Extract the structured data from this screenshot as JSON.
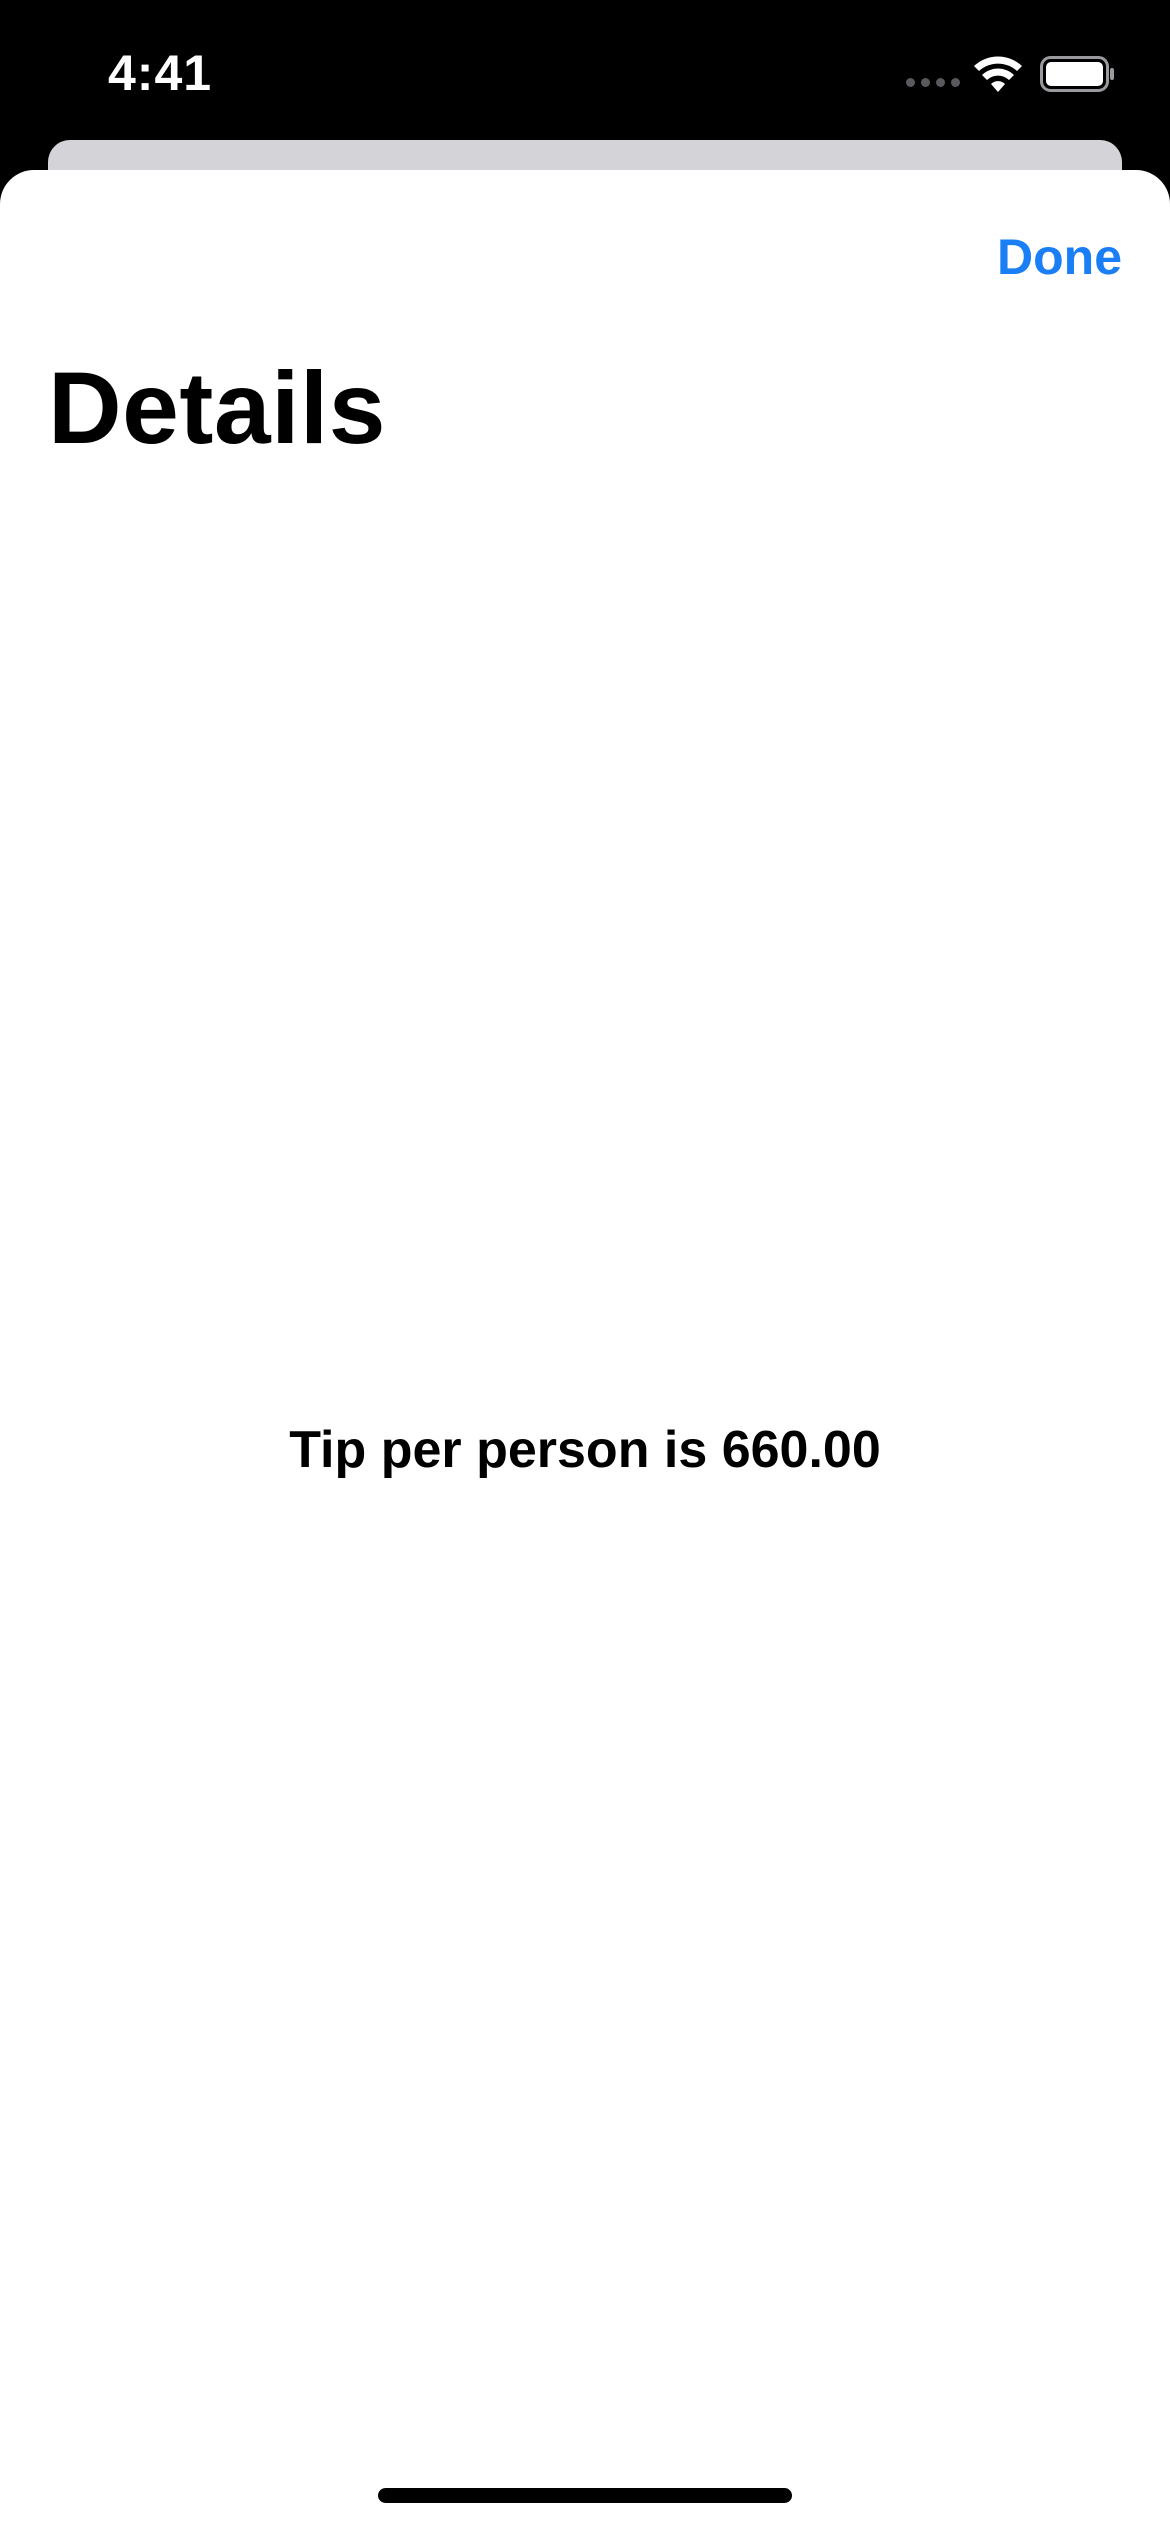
{
  "status_bar": {
    "time": "4:41",
    "icons": [
      "signal-icon",
      "wifi-icon",
      "battery-icon"
    ]
  },
  "sheet": {
    "done_label": "Done",
    "title": "Details",
    "tip_message": "Tip per person is 660.00"
  },
  "colors": {
    "accent": "#1a7ef5",
    "background": "#ffffff",
    "status_bar": "#000000",
    "back_card": "#d4d4d8"
  }
}
